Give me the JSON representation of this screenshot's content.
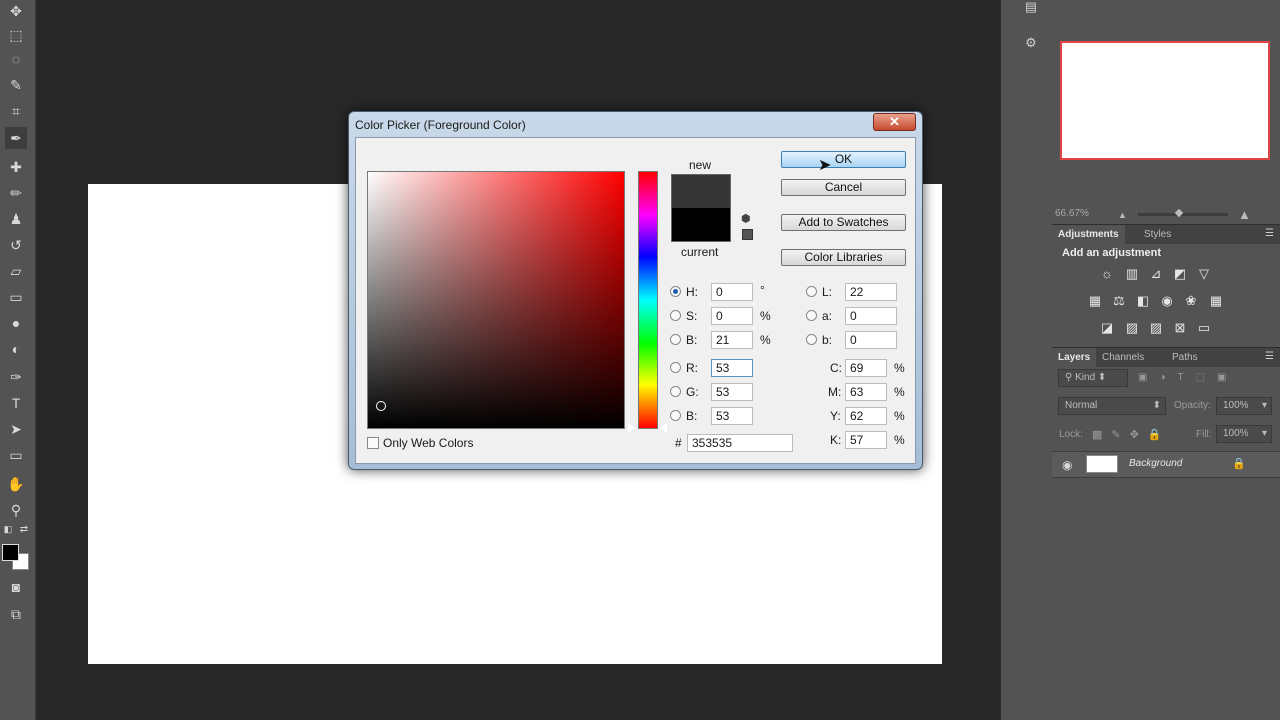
{
  "toolbar": {
    "tools": [
      "move-tool",
      "marquee-tool",
      "lasso-tool",
      "quick-select-tool",
      "crop-tool",
      "eyedropper-tool",
      "healing-brush-tool",
      "brush-tool",
      "clone-stamp-tool",
      "history-brush-tool",
      "eraser-tool",
      "gradient-tool",
      "blur-tool",
      "dodge-tool",
      "pen-tool",
      "type-tool",
      "path-select-tool",
      "shape-tool",
      "hand-tool",
      "zoom-tool"
    ]
  },
  "navigator": {
    "zoom": "66.67%"
  },
  "adjustments": {
    "tab_active": "Adjustments",
    "tab_other": "Styles",
    "title": "Add an adjustment"
  },
  "layers": {
    "tab_active": "Layers",
    "tab_channels": "Channels",
    "tab_paths": "Paths",
    "kind_label": "Kind",
    "blend_mode": "Normal",
    "opacity_label": "Opacity:",
    "opacity_value": "100%",
    "lock_label": "Lock:",
    "fill_label": "Fill:",
    "fill_value": "100%",
    "layer_name": "Background"
  },
  "dialog": {
    "title": "Color Picker (Foreground Color)",
    "close_glyph": "✕",
    "new_label": "new",
    "current_label": "current",
    "new_color": "#353535",
    "current_color": "#000000",
    "ok_label": "OK",
    "cancel_label": "Cancel",
    "add_swatches_label": "Add to Swatches",
    "color_libraries_label": "Color Libraries",
    "only_web_label": "Only Web Colors",
    "hash_label": "#",
    "hex_value": "353535",
    "hsb": [
      {
        "label": "H:",
        "value": "0",
        "unit": "°"
      },
      {
        "label": "S:",
        "value": "0",
        "unit": "%"
      },
      {
        "label": "B:",
        "value": "21",
        "unit": "%"
      }
    ],
    "rgb": [
      {
        "label": "R:",
        "value": "53"
      },
      {
        "label": "G:",
        "value": "53"
      },
      {
        "label": "B:",
        "value": "53"
      }
    ],
    "lab": [
      {
        "label": "L:",
        "value": "22"
      },
      {
        "label": "a:",
        "value": "0"
      },
      {
        "label": "b:",
        "value": "0"
      }
    ],
    "cmyk": [
      {
        "label": "C:",
        "value": "69",
        "unit": "%"
      },
      {
        "label": "M:",
        "value": "63",
        "unit": "%"
      },
      {
        "label": "Y:",
        "value": "62",
        "unit": "%"
      },
      {
        "label": "K:",
        "value": "57",
        "unit": "%"
      }
    ]
  }
}
